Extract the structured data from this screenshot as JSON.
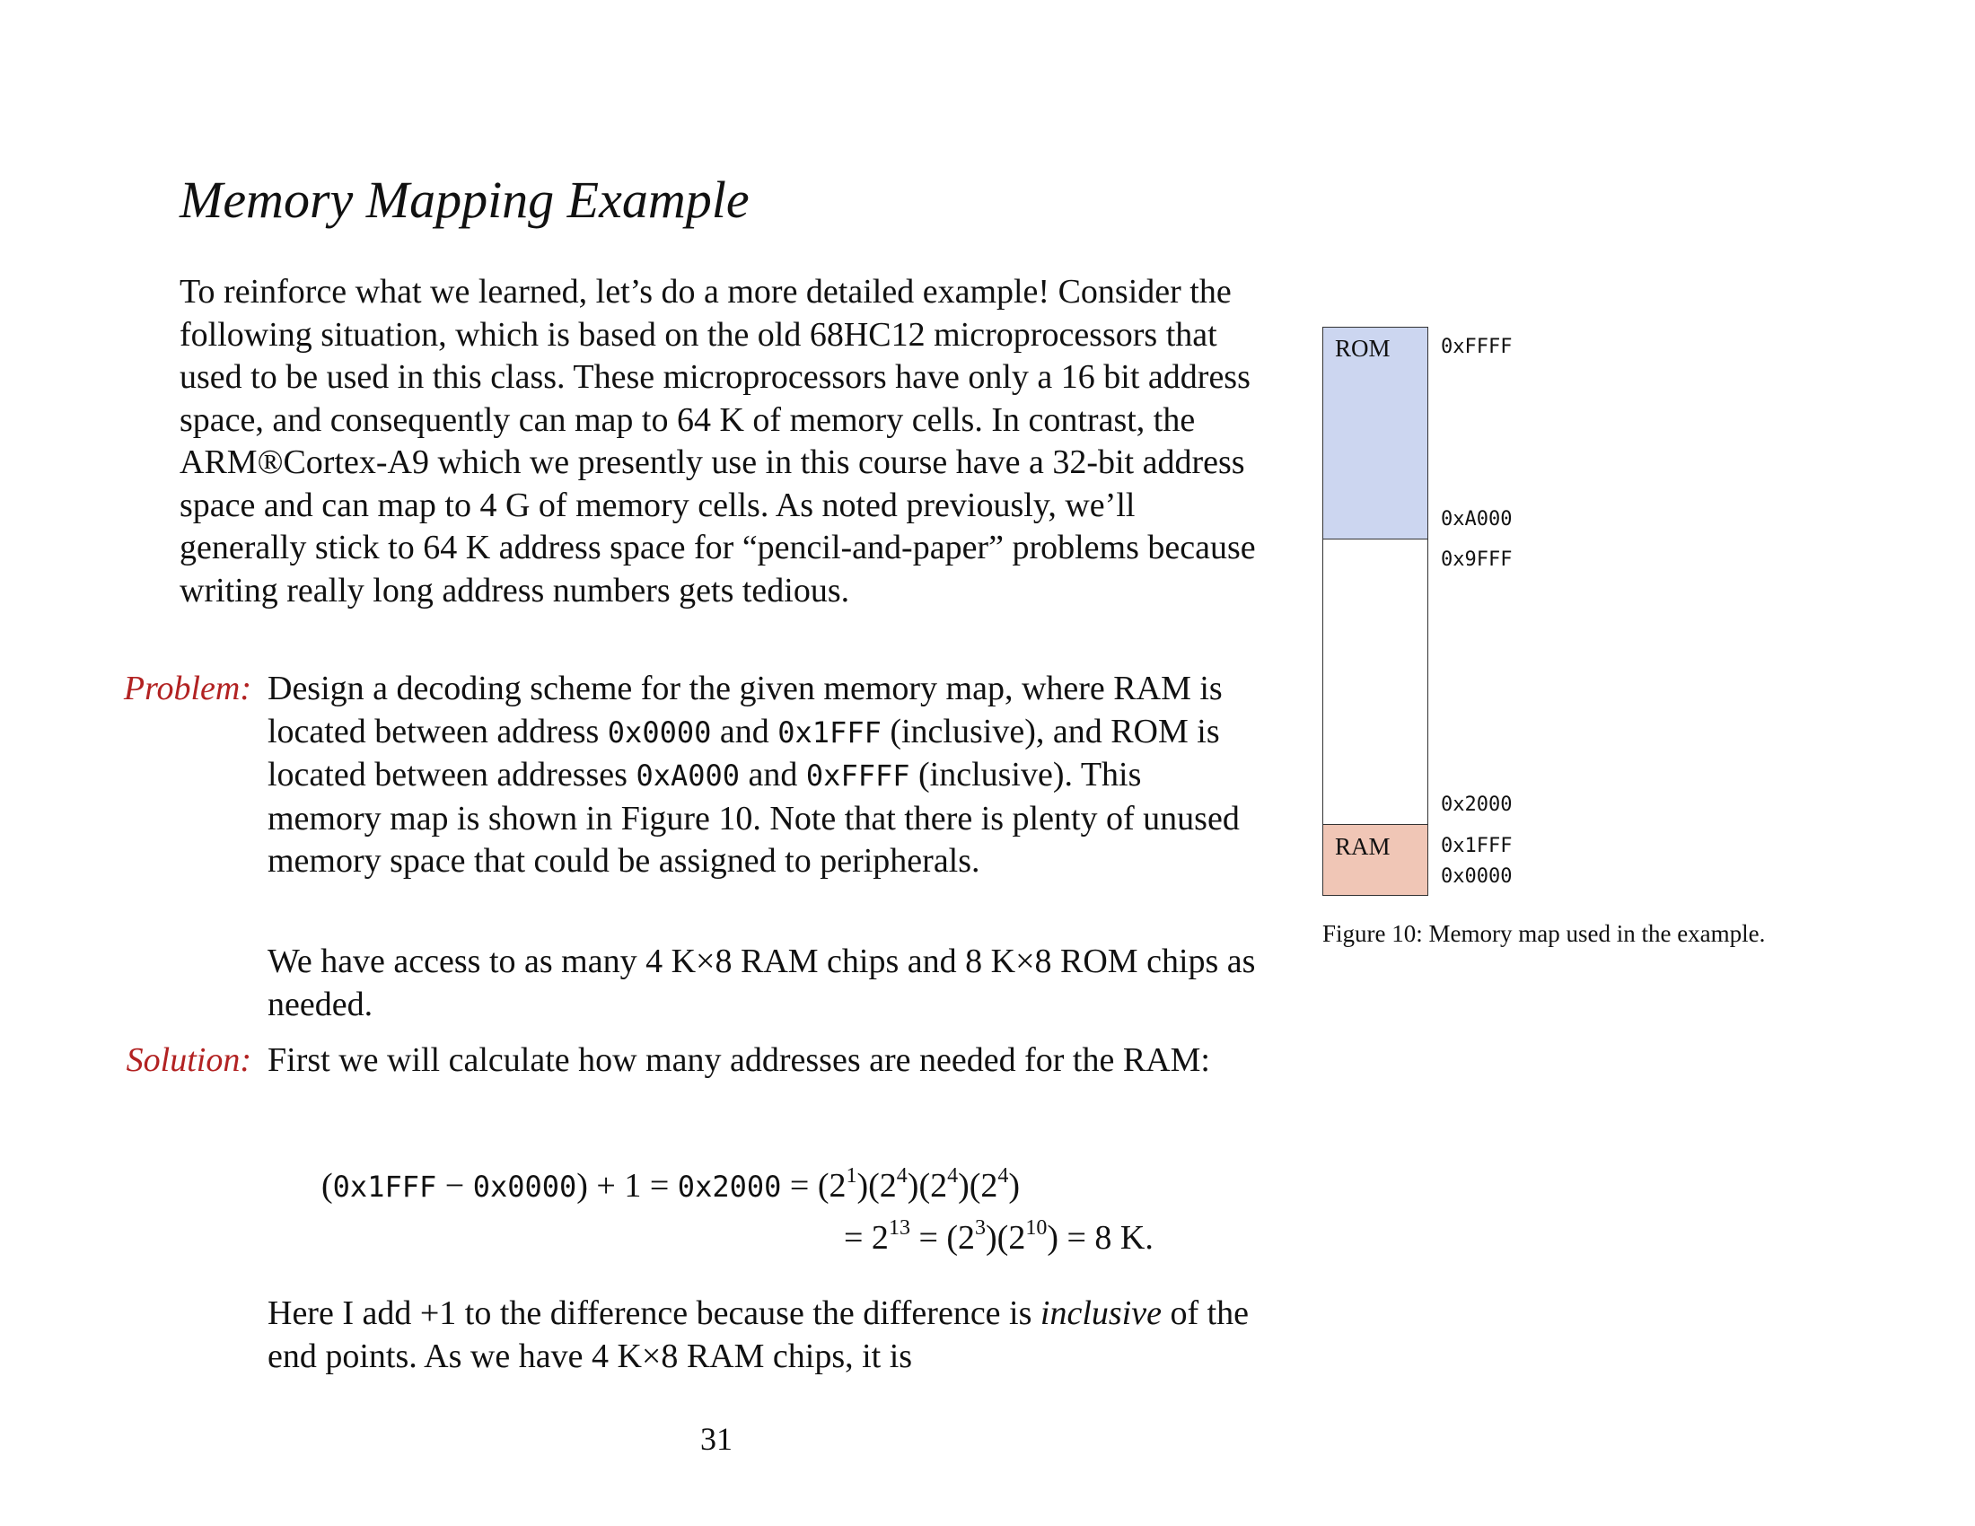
{
  "title": "Memory Mapping Example",
  "intro": {
    "t1": "To reinforce what we learned, let’s do a more detailed example! Consider the following situation, which is based on the old 68HC12 microprocessors that used to be used in this class. These micropro­cessors have only a 16 bit address space, and consequently can map to ",
    "m1": "64 K",
    "t2": " of memory cells. In contrast, the ARM®Cortex-A9 which we presently use in this course have a 32-bit address space and can map to ",
    "m2": "4 G",
    "t3": " of memory cells. As noted previously, we’ll generally stick to ",
    "m3": "64 K",
    "t4": " address space for “pencil-and-paper” problems be­cause writing really long address numbers gets tedious."
  },
  "problem": {
    "label": "Problem:",
    "t1": "Design a decoding scheme for the given memory map, where RAM is located between address ",
    "c1": "0x0000",
    "t2": " and ",
    "c2": "0x1FFF",
    "t3": " (inclu­sive), and ROM is located between addresses ",
    "c3": "0xA000",
    "t4": " and ",
    "c4": "0xFFFF",
    "t5": " (inclusive). This memory map is shown in Figure 10. Note that there is plenty of unused memory space that could be assigned to peripherals.",
    "p2_t1": "We have access to as many ",
    "p2_m1": "4 K×8",
    "p2_t2": " RAM chips and ",
    "p2_m2": "8 K×8",
    "p2_t3": " ROM chips as needed."
  },
  "solution": {
    "label": "Solution:",
    "t1": "First we will calculate how many addresses are needed for the RAM:",
    "eq1": {
      "open": "(",
      "a": "0x1FFF",
      "minus": " − ",
      "b": "0x0000",
      "rest": ") + 1 = ",
      "c": "0x2000",
      "eq": " = (2",
      "e1": "1",
      "p2": ")(2",
      "e2": "4",
      "p3": ")(2",
      "e3": "4",
      "p4": ")(2",
      "e4": "4",
      "close": ")"
    },
    "eq2": {
      "s1": "= 2",
      "e1": "13",
      "s2": " = (2",
      "e2": "3",
      "s3": ")(2",
      "e3": "10",
      "s4": ") = 8 K."
    },
    "after_t1": "Here I add ",
    "after_m1": "+1",
    "after_t2": " to the difference because the difference is ",
    "after_em": "in­clusive",
    "after_t3": " of the end points. As we have ",
    "after_m2": "4 K×8",
    "after_t4": " RAM chips, it is"
  },
  "page_number": "31",
  "memory_map": {
    "rom_label": "ROM",
    "ram_label": "RAM",
    "addresses": {
      "ffff": "0xFFFF",
      "a000": "0xA000",
      "9fff": "0x9FFF",
      "2000": "0x2000",
      "1fff": "0x1FFF",
      "0000": "0x0000"
    },
    "rom_color": "#ccd6f0",
    "ram_color": "#f0c6b6",
    "caption": "Figure 10: Memory map used in the example."
  },
  "colors": {
    "label_red": "#b22222"
  }
}
